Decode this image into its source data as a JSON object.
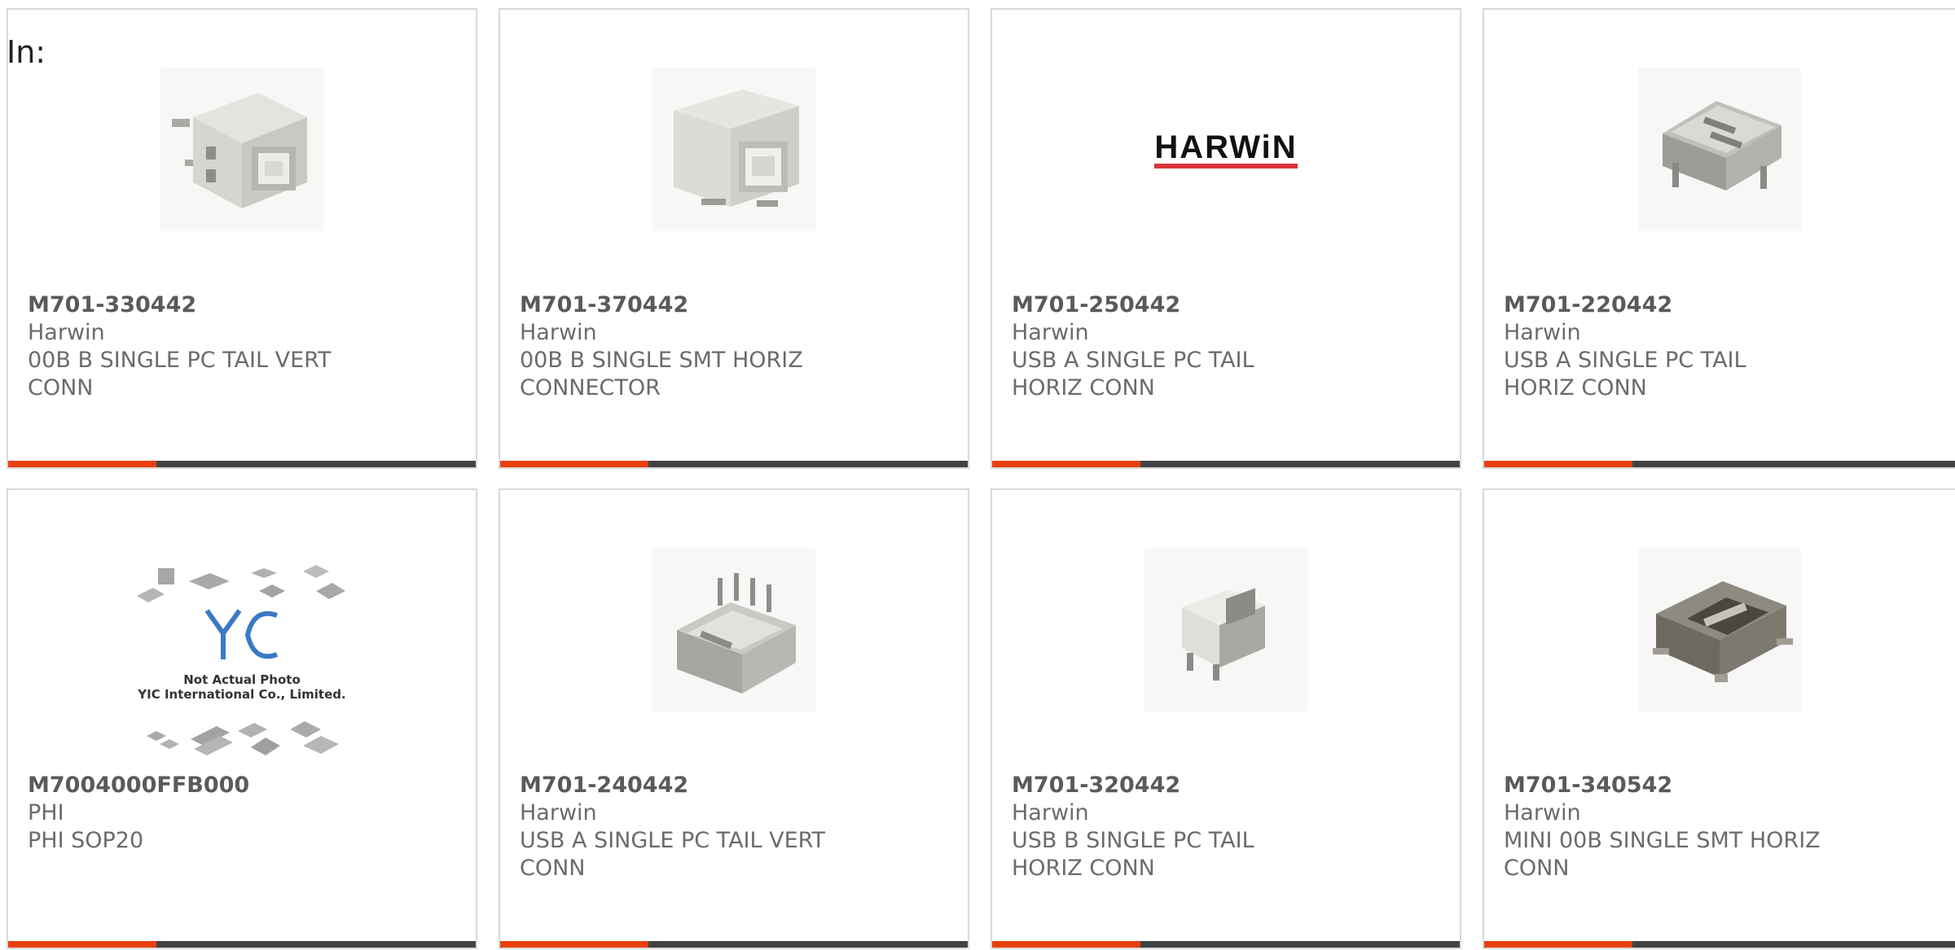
{
  "page": {
    "label": "In:",
    "accent_color": "#e8400d",
    "bar_color": "#3f4346",
    "border_color": "#d9d9d9"
  },
  "products": [
    {
      "part_number": "M701-330442",
      "manufacturer": "Harwin",
      "description": "00B B SINGLE PC TAIL VERT CONN",
      "image": "usb-b-vertical-connector-photo"
    },
    {
      "part_number": "M701-370442",
      "manufacturer": "Harwin",
      "description": "00B B SINGLE SMT HORIZ CONNECTOR",
      "image": "usb-b-smt-connector-photo"
    },
    {
      "part_number": "M701-250442",
      "manufacturer": "Harwin",
      "description": "USB A SINGLE PC TAIL HORIZ CONN",
      "image": "harwin-logo",
      "logo_text": "HARWiN"
    },
    {
      "part_number": "M701-220442",
      "manufacturer": "Harwin",
      "description": "USB A SINGLE PC TAIL HORIZ CONN",
      "image": "usb-a-horizontal-connector-photo"
    },
    {
      "part_number": "M7004000FFB000",
      "manufacturer": "PHI",
      "description": "PHI SOP20",
      "image": "yic-placeholder-image",
      "placeholder_line1": "Not Actual Photo",
      "placeholder_line2": "YIC International Co., Limited."
    },
    {
      "part_number": "M701-240442",
      "manufacturer": "Harwin",
      "description": "USB A SINGLE PC TAIL VERT CONN",
      "image": "usb-a-vertical-connector-photo"
    },
    {
      "part_number": "M701-320442",
      "manufacturer": "Harwin",
      "description": "USB B SINGLE PC TAIL HORIZ CONN",
      "image": "usb-b-horizontal-connector-photo"
    },
    {
      "part_number": "M701-340542",
      "manufacturer": "Harwin",
      "description": "MINI 00B SINGLE SMT HORIZ CONN",
      "image": "mini-usb-connector-photo"
    }
  ]
}
